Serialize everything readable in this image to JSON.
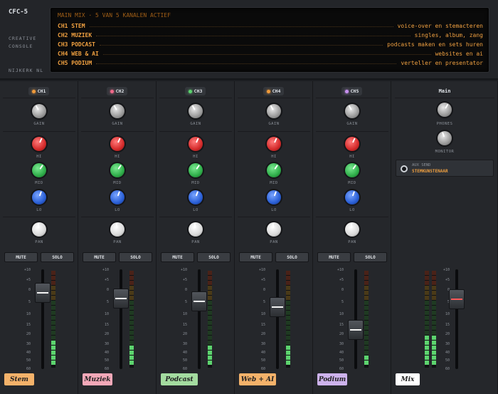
{
  "brand": {
    "name": "CFC-5",
    "line1": "CREATIVE",
    "line2": "CONSOLE",
    "location": "NIJKERK NL"
  },
  "display": {
    "title": "MAIN MIX · 5 VAN 5 KANALEN ACTIEF",
    "rows": [
      {
        "key": "CH1 STEM",
        "value": "voice-over en stemacteren"
      },
      {
        "key": "CH2 MUZIEK",
        "value": "singles, album, zang"
      },
      {
        "key": "CH3 PODCAST",
        "value": "podcasts maken en sets huren"
      },
      {
        "key": "CH4 WEB & AI",
        "value": "websites en ai"
      },
      {
        "key": "CH5 PODIUM",
        "value": "verteller en presentator"
      }
    ]
  },
  "knob_labels": {
    "gain": "GAIN",
    "hi": "HI",
    "mid": "MID",
    "lo": "LO",
    "pan": "PAN"
  },
  "buttons": {
    "mute": "MUTE",
    "solo": "SOLO"
  },
  "scale": [
    "+10",
    "+5",
    "0",
    "5",
    "10",
    "15",
    "20",
    "30",
    "40",
    "50",
    "60"
  ],
  "channels": [
    {
      "id": "CH1",
      "name": "Stem",
      "led": "#f09a3a",
      "tag": "#f4b26a",
      "fader": 0.17,
      "meter": 0.26
    },
    {
      "id": "CH2",
      "name": "Muziek",
      "led": "#f06a8a",
      "tag": "#f2a8b8",
      "fader": 0.24,
      "meter": 0.19
    },
    {
      "id": "CH3",
      "name": "Podcast",
      "led": "#5cd36e",
      "tag": "#a4dca0",
      "fader": 0.28,
      "meter": 0.22
    },
    {
      "id": "CH4",
      "name": "Web + AI",
      "led": "#f09a3a",
      "tag": "#f4b26a",
      "fader": 0.35,
      "meter": 0.22
    },
    {
      "id": "CH5",
      "name": "Podium",
      "led": "#c890f0",
      "tag": "#cdb2ec",
      "fader": 0.63,
      "meter": 0.13
    }
  ],
  "main": {
    "title": "Main",
    "phones": "PHONES",
    "monitor": "MONITOR",
    "aux_label": "AUX SEND",
    "aux_value": "STEMKUNSTENAAR",
    "name": "Mix",
    "tag": "#ffffff",
    "fader": 0.25,
    "meter_l": 0.33,
    "meter_r": 0.33
  }
}
